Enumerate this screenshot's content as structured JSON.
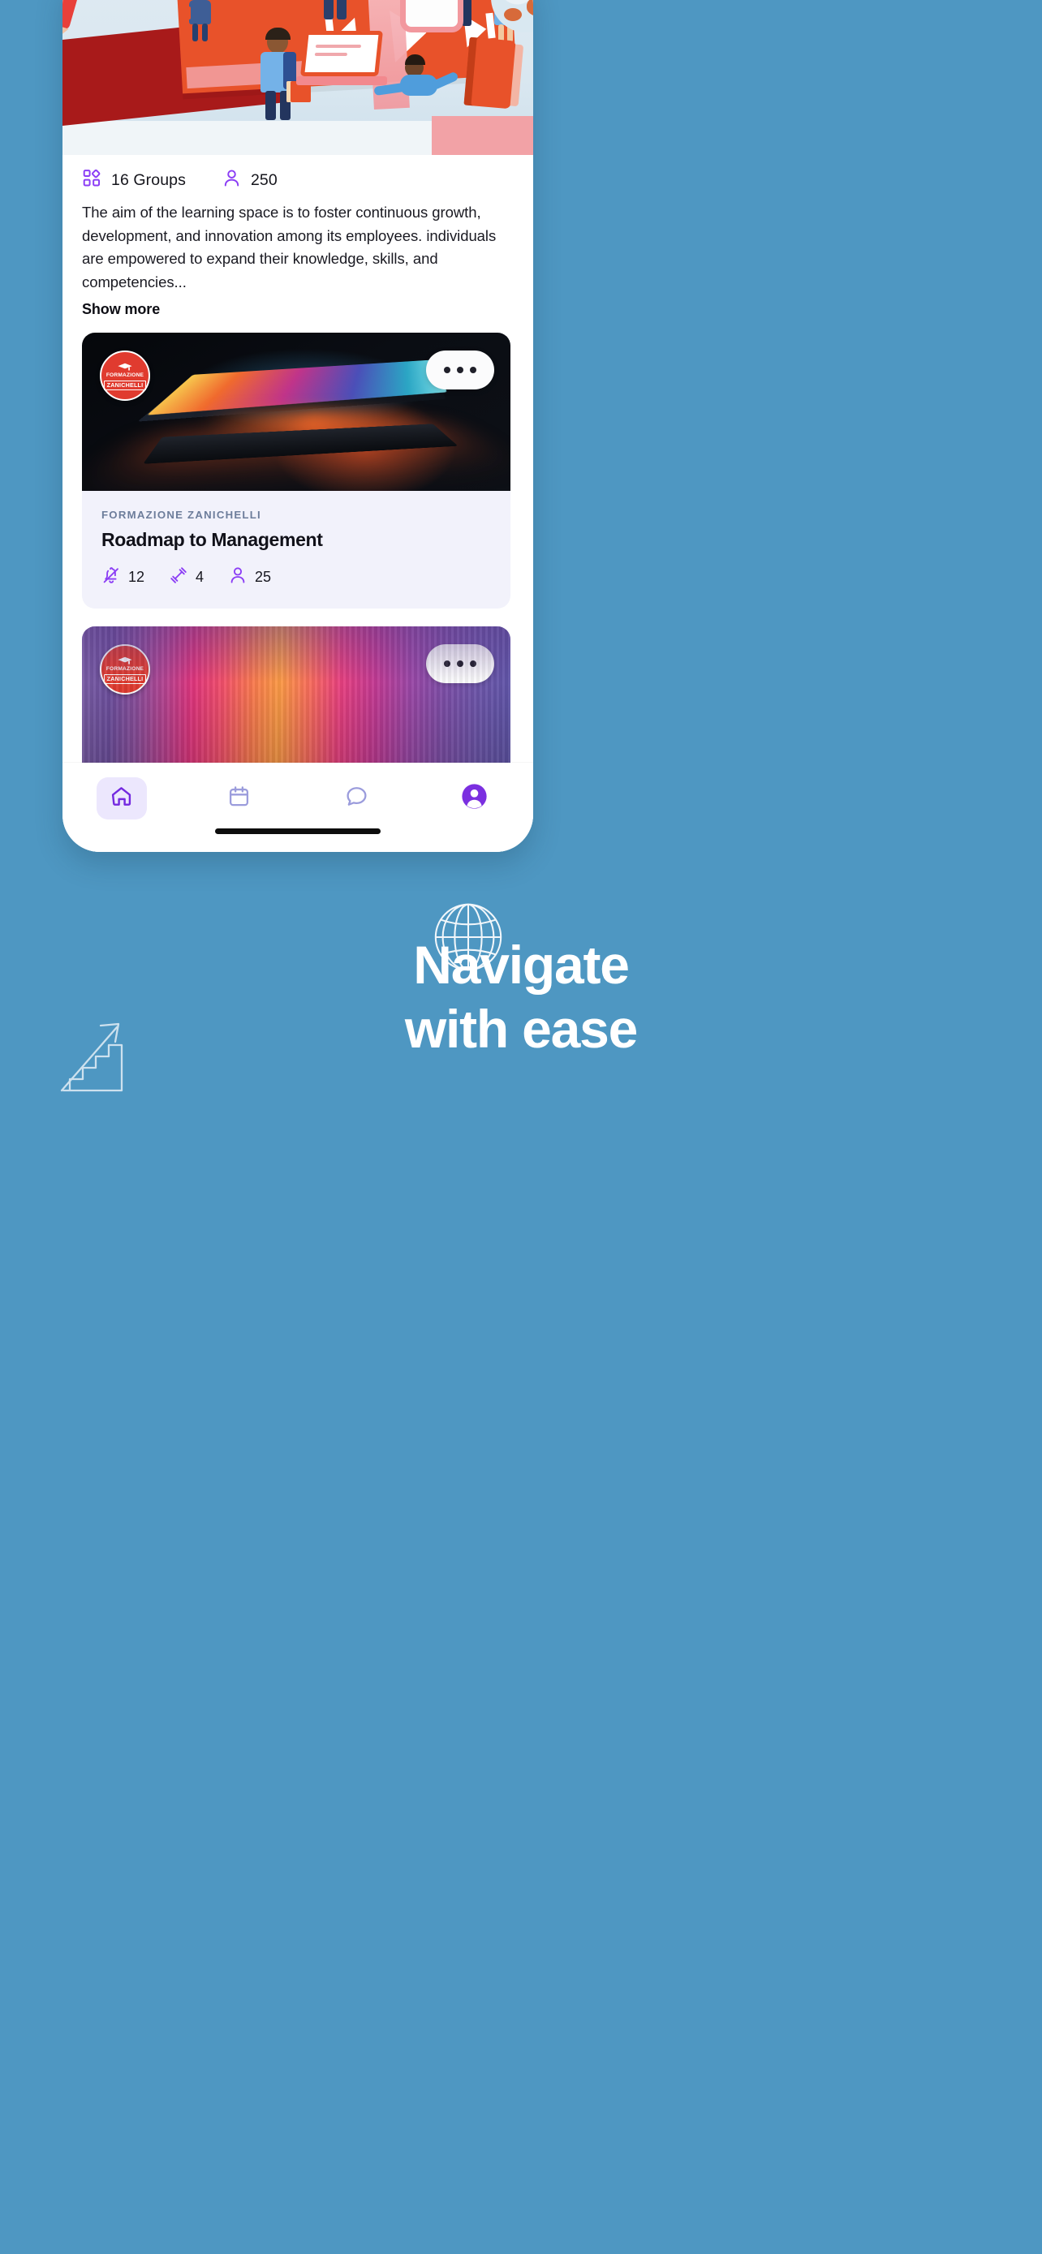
{
  "theme": {
    "background": "#4e97c2",
    "accent_purple": "#7c3aed",
    "card_body_bg": "#f2f2fb",
    "badge_red": "#e03b2f"
  },
  "phone": {
    "hero": {
      "alt": "learning-space-illustration"
    },
    "stats": [
      {
        "icon": "groups-grid-icon",
        "value": "16 Groups"
      },
      {
        "icon": "person-icon",
        "value": "250"
      }
    ],
    "description": "The aim of the learning space is to foster continuous growth, development, and innovation among its employees. individuals are empowered to expand their knowledge, skills, and competencies...",
    "show_more_label": "Show more",
    "cards": [
      {
        "badge": {
          "cap_icon": "graduation-cap-icon",
          "line1": "FORMAZIONE",
          "line2": "ZANICHELLI"
        },
        "menu_icon": "more-options-icon",
        "image": "laptop-dark-photo",
        "eyebrow": "FORMAZIONE ZANICHELLI",
        "title": "Roadmap to Management",
        "metrics": [
          {
            "icon": "bell-off-icon",
            "value": "12"
          },
          {
            "icon": "dumbbell-icon",
            "value": "4"
          },
          {
            "icon": "person-icon",
            "value": "25"
          }
        ]
      },
      {
        "badge": {
          "cap_icon": "graduation-cap-icon",
          "line1": "FORMAZIONE",
          "line2": "ZANICHELLI"
        },
        "menu_icon": "more-options-icon",
        "image": "colorful-gradient-photo"
      }
    ],
    "nav": [
      {
        "icon": "home-icon",
        "active": true
      },
      {
        "icon": "calendar-icon",
        "active": false
      },
      {
        "icon": "chat-bubble-icon",
        "active": false
      },
      {
        "icon": "profile-avatar-icon",
        "active": false
      }
    ]
  },
  "marketing": {
    "headline_line1": "Navigate",
    "headline_line2": "with ease",
    "decorations": [
      {
        "icon": "globe-outline-icon"
      },
      {
        "icon": "stairs-arrow-up-icon"
      }
    ]
  }
}
